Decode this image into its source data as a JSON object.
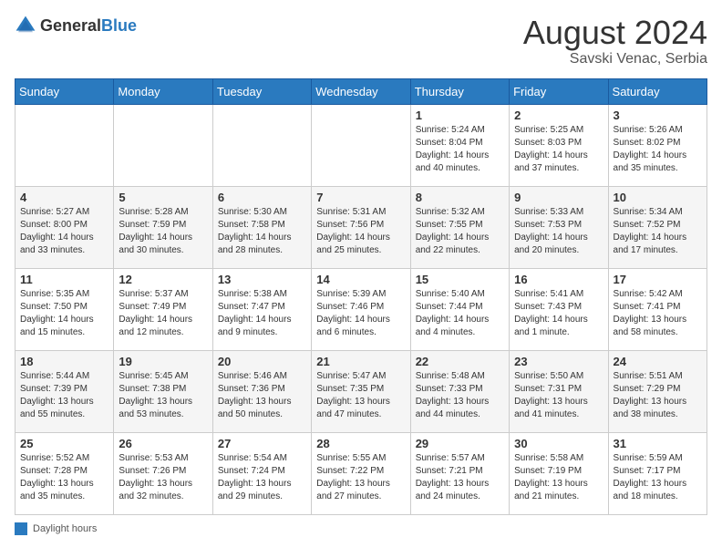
{
  "header": {
    "logo_general": "General",
    "logo_blue": "Blue",
    "month_year": "August 2024",
    "location": "Savski Venac, Serbia"
  },
  "days_of_week": [
    "Sunday",
    "Monday",
    "Tuesday",
    "Wednesday",
    "Thursday",
    "Friday",
    "Saturday"
  ],
  "footer": {
    "label": "Daylight hours"
  },
  "weeks": [
    [
      {
        "day": "",
        "sunrise": "",
        "sunset": "",
        "daylight": ""
      },
      {
        "day": "",
        "sunrise": "",
        "sunset": "",
        "daylight": ""
      },
      {
        "day": "",
        "sunrise": "",
        "sunset": "",
        "daylight": ""
      },
      {
        "day": "",
        "sunrise": "",
        "sunset": "",
        "daylight": ""
      },
      {
        "day": "1",
        "sunrise": "5:24 AM",
        "sunset": "8:04 PM",
        "daylight": "14 hours and 40 minutes."
      },
      {
        "day": "2",
        "sunrise": "5:25 AM",
        "sunset": "8:03 PM",
        "daylight": "14 hours and 37 minutes."
      },
      {
        "day": "3",
        "sunrise": "5:26 AM",
        "sunset": "8:02 PM",
        "daylight": "14 hours and 35 minutes."
      }
    ],
    [
      {
        "day": "4",
        "sunrise": "5:27 AM",
        "sunset": "8:00 PM",
        "daylight": "14 hours and 33 minutes."
      },
      {
        "day": "5",
        "sunrise": "5:28 AM",
        "sunset": "7:59 PM",
        "daylight": "14 hours and 30 minutes."
      },
      {
        "day": "6",
        "sunrise": "5:30 AM",
        "sunset": "7:58 PM",
        "daylight": "14 hours and 28 minutes."
      },
      {
        "day": "7",
        "sunrise": "5:31 AM",
        "sunset": "7:56 PM",
        "daylight": "14 hours and 25 minutes."
      },
      {
        "day": "8",
        "sunrise": "5:32 AM",
        "sunset": "7:55 PM",
        "daylight": "14 hours and 22 minutes."
      },
      {
        "day": "9",
        "sunrise": "5:33 AM",
        "sunset": "7:53 PM",
        "daylight": "14 hours and 20 minutes."
      },
      {
        "day": "10",
        "sunrise": "5:34 AM",
        "sunset": "7:52 PM",
        "daylight": "14 hours and 17 minutes."
      }
    ],
    [
      {
        "day": "11",
        "sunrise": "5:35 AM",
        "sunset": "7:50 PM",
        "daylight": "14 hours and 15 minutes."
      },
      {
        "day": "12",
        "sunrise": "5:37 AM",
        "sunset": "7:49 PM",
        "daylight": "14 hours and 12 minutes."
      },
      {
        "day": "13",
        "sunrise": "5:38 AM",
        "sunset": "7:47 PM",
        "daylight": "14 hours and 9 minutes."
      },
      {
        "day": "14",
        "sunrise": "5:39 AM",
        "sunset": "7:46 PM",
        "daylight": "14 hours and 6 minutes."
      },
      {
        "day": "15",
        "sunrise": "5:40 AM",
        "sunset": "7:44 PM",
        "daylight": "14 hours and 4 minutes."
      },
      {
        "day": "16",
        "sunrise": "5:41 AM",
        "sunset": "7:43 PM",
        "daylight": "14 hours and 1 minute."
      },
      {
        "day": "17",
        "sunrise": "5:42 AM",
        "sunset": "7:41 PM",
        "daylight": "13 hours and 58 minutes."
      }
    ],
    [
      {
        "day": "18",
        "sunrise": "5:44 AM",
        "sunset": "7:39 PM",
        "daylight": "13 hours and 55 minutes."
      },
      {
        "day": "19",
        "sunrise": "5:45 AM",
        "sunset": "7:38 PM",
        "daylight": "13 hours and 53 minutes."
      },
      {
        "day": "20",
        "sunrise": "5:46 AM",
        "sunset": "7:36 PM",
        "daylight": "13 hours and 50 minutes."
      },
      {
        "day": "21",
        "sunrise": "5:47 AM",
        "sunset": "7:35 PM",
        "daylight": "13 hours and 47 minutes."
      },
      {
        "day": "22",
        "sunrise": "5:48 AM",
        "sunset": "7:33 PM",
        "daylight": "13 hours and 44 minutes."
      },
      {
        "day": "23",
        "sunrise": "5:50 AM",
        "sunset": "7:31 PM",
        "daylight": "13 hours and 41 minutes."
      },
      {
        "day": "24",
        "sunrise": "5:51 AM",
        "sunset": "7:29 PM",
        "daylight": "13 hours and 38 minutes."
      }
    ],
    [
      {
        "day": "25",
        "sunrise": "5:52 AM",
        "sunset": "7:28 PM",
        "daylight": "13 hours and 35 minutes."
      },
      {
        "day": "26",
        "sunrise": "5:53 AM",
        "sunset": "7:26 PM",
        "daylight": "13 hours and 32 minutes."
      },
      {
        "day": "27",
        "sunrise": "5:54 AM",
        "sunset": "7:24 PM",
        "daylight": "13 hours and 29 minutes."
      },
      {
        "day": "28",
        "sunrise": "5:55 AM",
        "sunset": "7:22 PM",
        "daylight": "13 hours and 27 minutes."
      },
      {
        "day": "29",
        "sunrise": "5:57 AM",
        "sunset": "7:21 PM",
        "daylight": "13 hours and 24 minutes."
      },
      {
        "day": "30",
        "sunrise": "5:58 AM",
        "sunset": "7:19 PM",
        "daylight": "13 hours and 21 minutes."
      },
      {
        "day": "31",
        "sunrise": "5:59 AM",
        "sunset": "7:17 PM",
        "daylight": "13 hours and 18 minutes."
      }
    ]
  ]
}
